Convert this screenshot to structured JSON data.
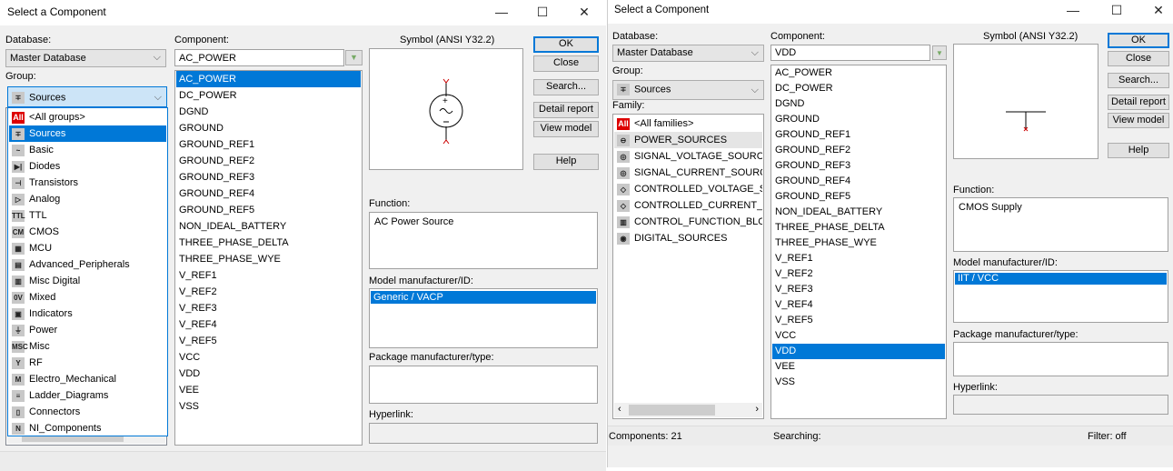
{
  "left": {
    "title": "Select a Component",
    "database_label": "Database:",
    "database_value": "Master Database",
    "group_label": "Group:",
    "group_value": "Sources",
    "group_options": [
      {
        "label": "<All groups>",
        "icon": "all-icon",
        "glyph": "All"
      },
      {
        "label": "Sources",
        "icon": "sources-icon",
        "glyph": "∓",
        "selected": true
      },
      {
        "label": "Basic",
        "icon": "basic-icon",
        "glyph": "~"
      },
      {
        "label": "Diodes",
        "icon": "diodes-icon",
        "glyph": "▶|"
      },
      {
        "label": "Transistors",
        "icon": "transistors-icon",
        "glyph": "⊣"
      },
      {
        "label": "Analog",
        "icon": "analog-icon",
        "glyph": "▷"
      },
      {
        "label": "TTL",
        "icon": "ttl-icon",
        "glyph": "TTL"
      },
      {
        "label": "CMOS",
        "icon": "cmos-icon",
        "glyph": "CM"
      },
      {
        "label": "MCU",
        "icon": "mcu-icon",
        "glyph": "▦"
      },
      {
        "label": "Advanced_Peripherals",
        "icon": "peripherals-icon",
        "glyph": "▤"
      },
      {
        "label": "Misc Digital",
        "icon": "misc-digital-icon",
        "glyph": "▥"
      },
      {
        "label": "Mixed",
        "icon": "mixed-icon",
        "glyph": "0V"
      },
      {
        "label": "Indicators",
        "icon": "indicators-icon",
        "glyph": "▣"
      },
      {
        "label": "Power",
        "icon": "power-icon",
        "glyph": "⏚"
      },
      {
        "label": "Misc",
        "icon": "misc-icon",
        "glyph": "MSC"
      },
      {
        "label": "RF",
        "icon": "rf-icon",
        "glyph": "Y"
      },
      {
        "label": "Electro_Mechanical",
        "icon": "electro-mechanical-icon",
        "glyph": "M"
      },
      {
        "label": "Ladder_Diagrams",
        "icon": "ladder-icon",
        "glyph": "≡"
      },
      {
        "label": "Connectors",
        "icon": "connectors-icon",
        "glyph": "▯"
      },
      {
        "label": "NI_Components",
        "icon": "ni-icon",
        "glyph": "N"
      }
    ],
    "component_label": "Component:",
    "component_value": "AC_POWER",
    "components": [
      "AC_POWER",
      "DC_POWER",
      "DGND",
      "GROUND",
      "GROUND_REF1",
      "GROUND_REF2",
      "GROUND_REF3",
      "GROUND_REF4",
      "GROUND_REF5",
      "NON_IDEAL_BATTERY",
      "THREE_PHASE_DELTA",
      "THREE_PHASE_WYE",
      "V_REF1",
      "V_REF2",
      "V_REF3",
      "V_REF4",
      "V_REF5",
      "VCC",
      "VDD",
      "VEE",
      "VSS"
    ],
    "selected_component": "AC_POWER",
    "symbol_label": "Symbol (ANSI Y32.2)",
    "buttons": {
      "ok": "OK",
      "close": "Close",
      "search": "Search...",
      "detail": "Detail report",
      "view_model": "View model",
      "help": "Help"
    },
    "function_label": "Function:",
    "function_value": "AC Power Source",
    "model_label": "Model manufacturer/ID:",
    "model_value": "Generic / VACP",
    "package_label": "Package manufacturer/type:",
    "hyperlink_label": "Hyperlink:"
  },
  "right": {
    "title": "Select a Component",
    "database_label": "Database:",
    "database_value": "Master Database",
    "group_label": "Group:",
    "group_value": "Sources",
    "family_label": "Family:",
    "families": [
      {
        "label": "<All families>",
        "icon": "all-icon",
        "glyph": "All"
      },
      {
        "label": "POWER_SOURCES",
        "icon": "power-sources-icon",
        "glyph": "⊖",
        "selected": true
      },
      {
        "label": "SIGNAL_VOLTAGE_SOURCES",
        "icon": "signal-voltage-icon",
        "glyph": "◎"
      },
      {
        "label": "SIGNAL_CURRENT_SOURCES",
        "icon": "signal-current-icon",
        "glyph": "◎"
      },
      {
        "label": "CONTROLLED_VOLTAGE_SOURCES",
        "icon": "controlled-voltage-icon",
        "glyph": "◇"
      },
      {
        "label": "CONTROLLED_CURRENT_SOURCES",
        "icon": "controlled-current-icon",
        "glyph": "◇"
      },
      {
        "label": "CONTROL_FUNCTION_BLOCKS",
        "icon": "control-function-icon",
        "glyph": "▥"
      },
      {
        "label": "DIGITAL_SOURCES",
        "icon": "digital-sources-icon",
        "glyph": "◉"
      }
    ],
    "component_label": "Component:",
    "component_value": "VDD",
    "components": [
      "AC_POWER",
      "DC_POWER",
      "DGND",
      "GROUND",
      "GROUND_REF1",
      "GROUND_REF2",
      "GROUND_REF3",
      "GROUND_REF4",
      "GROUND_REF5",
      "NON_IDEAL_BATTERY",
      "THREE_PHASE_DELTA",
      "THREE_PHASE_WYE",
      "V_REF1",
      "V_REF2",
      "V_REF3",
      "V_REF4",
      "V_REF5",
      "VCC",
      "VDD",
      "VEE",
      "VSS"
    ],
    "selected_component": "VDD",
    "symbol_label": "Symbol (ANSI Y32.2)",
    "buttons": {
      "ok": "OK",
      "close": "Close",
      "search": "Search...",
      "detail": "Detail report",
      "view_model": "View model",
      "help": "Help"
    },
    "function_label": "Function:",
    "function_value": "CMOS Supply",
    "model_label": "Model manufacturer/ID:",
    "model_value": "IIT / VCC",
    "package_label": "Package manufacturer/type:",
    "hyperlink_label": "Hyperlink:",
    "status": {
      "components": "Components: 21",
      "searching": "Searching:",
      "filter": "Filter: off"
    }
  },
  "colors": {
    "selection": "#0078d7",
    "dialog_bg": "#f0f0f0",
    "pin_marker": "#cc0000"
  }
}
